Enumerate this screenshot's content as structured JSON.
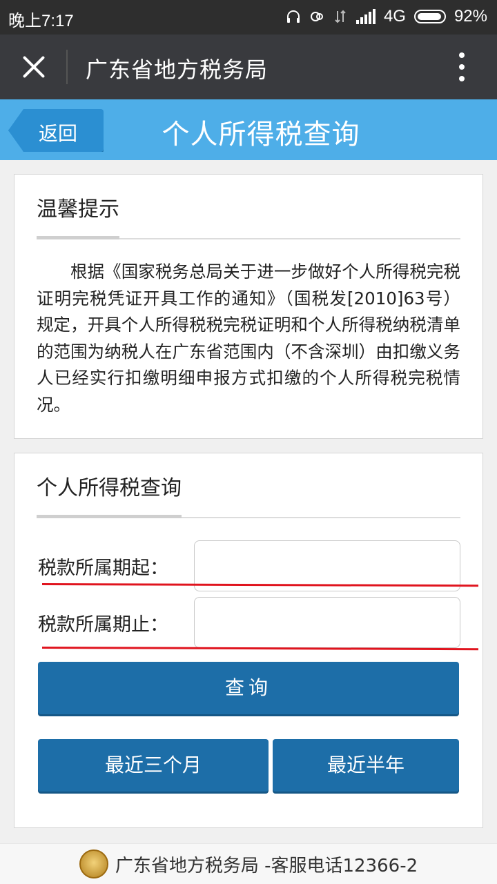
{
  "status_bar": {
    "time": "晚上7:17",
    "network": "4G",
    "battery": "92%"
  },
  "nav": {
    "title": "广东省地方税务局"
  },
  "header": {
    "back_label": "返回",
    "title": "个人所得税查询"
  },
  "notice_card": {
    "title": "温馨提示",
    "body": "根据《国家税务总局关于进一步做好个人所得税完税证明完税凭证开具工作的通知》（国税发[2010]63号）规定，开具个人所得税税完税证明和个人所得税纳税清单的范围为纳税人在广东省范围内（不含深圳）由扣缴义务人已经实行扣缴明细申报方式扣缴的个人所得税完税情况。"
  },
  "query_card": {
    "title": "个人所得税查询",
    "start_label": "税款所属期起：",
    "start_value": "",
    "end_label": "税款所属期止：",
    "end_value": "",
    "query_button": "查询",
    "last3_button": "最近三个月",
    "last6_button": "最近半年"
  },
  "footer": {
    "text": "广东省地方税务局 -客服电话12366-2"
  },
  "colors": {
    "nav_bg": "#393a3e",
    "header_bg": "#4eaee8",
    "button_bg": "#1d6ea8",
    "annotation_red": "#e0141e"
  }
}
